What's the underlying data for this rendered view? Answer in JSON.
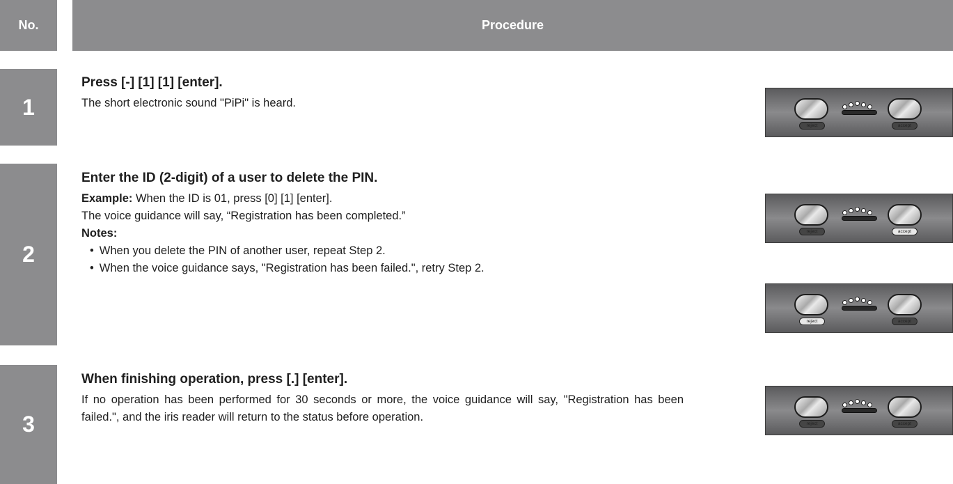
{
  "header": {
    "no_label": "No.",
    "procedure_label": "Procedure"
  },
  "steps": [
    {
      "number": "1",
      "title": "Press [-] [1] [1] [enter].",
      "text": "The short electronic sound \"PiPi\" is heard."
    },
    {
      "number": "2",
      "title": "Enter the ID (2-digit) of a user to delete the PIN.",
      "example_label": "Example:",
      "example_text": " When the ID is 01, press [0] [1] [enter].",
      "text": "The voice guidance will say, “Registration has been completed.”",
      "notes_label": "Notes:",
      "notes": [
        "When you delete the PIN of another user, repeat Step 2.",
        "When the voice guidance says, \"Registration has been failed.\", retry Step 2."
      ]
    },
    {
      "number": "3",
      "title": "When finishing operation, press [.] [enter].",
      "text": "If no operation has been performed for 30 seconds or more, the voice guidance will say, \"Registration has been failed.\", and the iris reader will return to the status before operation."
    }
  ],
  "panels": [
    {
      "reject_label": "reject",
      "accept_label": "accept",
      "lit": "none"
    },
    {
      "reject_label": "reject",
      "accept_label": "accept",
      "lit": "accept"
    },
    {
      "reject_label": "reject",
      "accept_label": "accept",
      "lit": "reject"
    },
    {
      "reject_label": "reject",
      "accept_label": "accept",
      "lit": "none"
    }
  ]
}
